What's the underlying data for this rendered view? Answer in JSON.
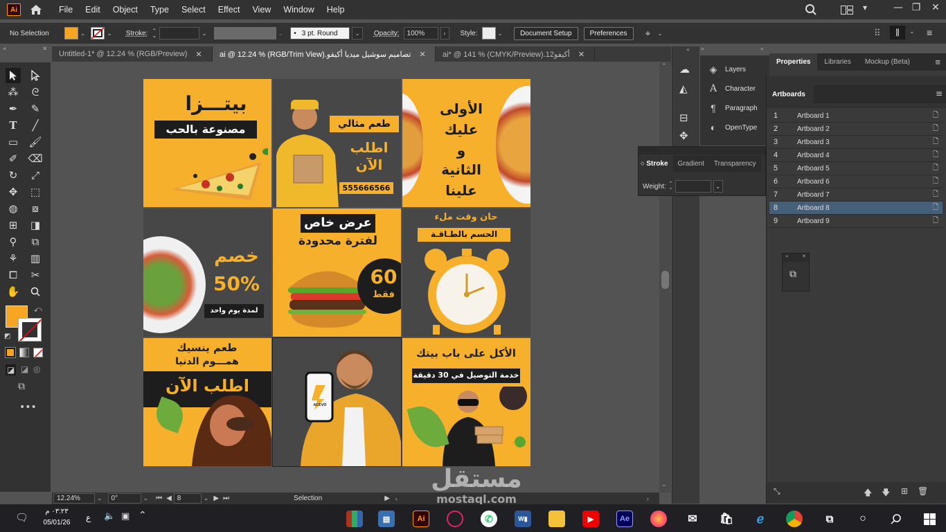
{
  "menubar": {
    "app_icon": "Ai",
    "items": [
      "File",
      "Edit",
      "Object",
      "Type",
      "Select",
      "Effect",
      "View",
      "Window",
      "Help"
    ]
  },
  "controlbar": {
    "selection": "No Selection",
    "stroke_label": "Stroke:",
    "brush": "3 pt. Round",
    "opacity_label": "Opacity:",
    "opacity": "100%",
    "style_label": "Style:",
    "document_setup": "Document Setup",
    "preferences": "Preferences",
    "fill_color": "#f6a623"
  },
  "tabs": [
    {
      "label": "Untitled-1* @ 12.24 % (RGB/Preview)",
      "active": false
    },
    {
      "label": "تصاميم سوشيل ميديا أكيفو.ai @ 12.24 % (RGB/Trim View)",
      "active": true
    },
    {
      "label": "أكيفو12.ai* @ 141 % (CMYK/Preview)",
      "active": false
    }
  ],
  "artboards_content": {
    "a1": {
      "title": "بيتـــزا",
      "sub": "مصنوعة بالحب"
    },
    "a2": {
      "t1": "طعم مثالي",
      "t2": "اطلب",
      "t3": "الآن",
      "phone": "555666566"
    },
    "a3": {
      "l1": "الأولى",
      "l2": "عليك",
      "l3": "و",
      "l4": "الثانية",
      "l5": "علينا"
    },
    "a4": {
      "t1": "خصم",
      "t2": "50%",
      "t3": "لمدة يوم واحد"
    },
    "a5": {
      "t1": "عرض خاص",
      "t2": "لفترة محدودة",
      "n": "60",
      "u": "فقط"
    },
    "a6": {
      "t1": "حان وقت ملء",
      "t2": "الحسم بالطـاقـة"
    },
    "a7": {
      "t1": "طعم ينسيك",
      "t2": "همـــوم الدنيا",
      "t3": "اطلب الآن"
    },
    "a8": {
      "logo": "ACEVO"
    },
    "a9": {
      "t1": "الأكل على باب بيتك",
      "t2": "خدمة التوصيل في 30 دقيقة"
    }
  },
  "statusbar": {
    "zoom": "12.24%",
    "rotation": "0°",
    "artboard_nav": "8",
    "tool": "Selection"
  },
  "midpanel": {
    "items": [
      "Layers",
      "Character",
      "Paragraph",
      "OpenType"
    ]
  },
  "strokepanel": {
    "tabs": [
      "Stroke",
      "Gradient",
      "Transparency"
    ],
    "weight_label": "Weight:"
  },
  "rightpanel": {
    "tabs": [
      "Properties",
      "Libraries",
      "Mockup (Beta)"
    ],
    "artboards_title": "Artboards",
    "artboards": [
      {
        "num": "1",
        "name": "Artboard 1"
      },
      {
        "num": "2",
        "name": "Artboard 2"
      },
      {
        "num": "3",
        "name": "Artboard 3"
      },
      {
        "num": "4",
        "name": "Artboard 4"
      },
      {
        "num": "5",
        "name": "Artboard 5"
      },
      {
        "num": "6",
        "name": "Artboard 6"
      },
      {
        "num": "7",
        "name": "Artboard 7"
      },
      {
        "num": "8",
        "name": "Artboard 8"
      },
      {
        "num": "9",
        "name": "Artboard 9"
      }
    ]
  },
  "taskbar": {
    "time": "٠٣:٢٣ م",
    "date": "05/01/26",
    "lang": "ع"
  },
  "watermark": {
    "ar": "مستقل",
    "en": "mostaql.com"
  }
}
